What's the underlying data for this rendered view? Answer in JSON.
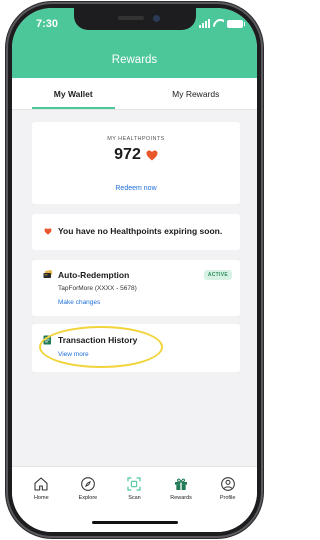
{
  "status_bar": {
    "time": "7:30"
  },
  "header": {
    "title": "Rewards"
  },
  "tabs": [
    {
      "label": "My Wallet",
      "active": true
    },
    {
      "label": "My Rewards",
      "active": false
    }
  ],
  "points": {
    "label": "MY HEALTHPOINTS",
    "value": "972",
    "redeem_label": "Redeem now"
  },
  "expiry": {
    "message": "You have no Healthpoints expiring soon."
  },
  "auto_redemption": {
    "title": "Auto-Redemption",
    "badge": "ACTIVE",
    "subtitle": "TapForMore (XXXX - 5678)",
    "link": "Make changes"
  },
  "transaction_history": {
    "title": "Transaction History",
    "link": "View more"
  },
  "bottom_nav": [
    {
      "label": "Home",
      "icon": "home-icon"
    },
    {
      "label": "Explore",
      "icon": "compass-icon"
    },
    {
      "label": "Scan",
      "icon": "scan-icon"
    },
    {
      "label": "Rewards",
      "icon": "gift-icon"
    },
    {
      "label": "Profile",
      "icon": "profile-icon"
    }
  ],
  "colors": {
    "brand_green": "#4cc79a",
    "heart_orange": "#e8562a",
    "link_blue": "#1e6ed8",
    "highlight_yellow": "#f2d43a",
    "badge_green": "#2f8d62"
  }
}
